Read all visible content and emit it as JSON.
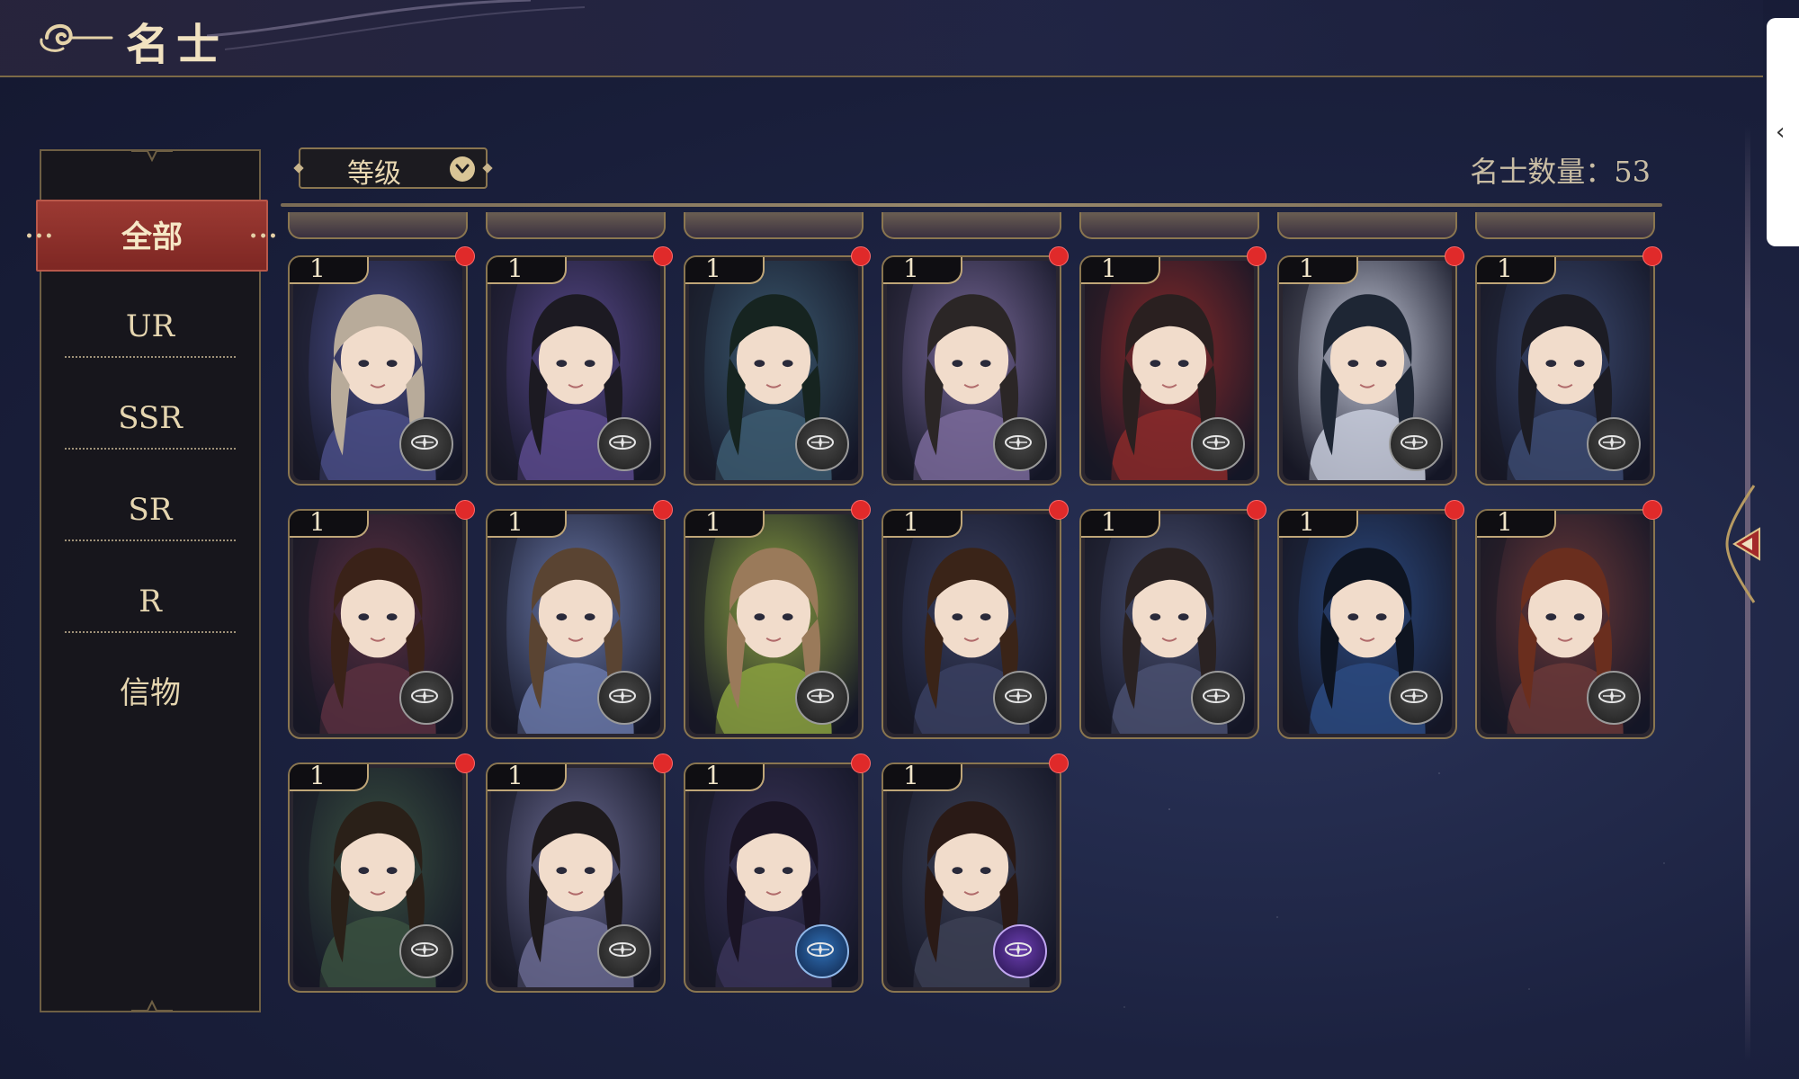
{
  "header": {
    "title": "名士",
    "back_icon": "cloud-swirl-back-icon"
  },
  "filters": [
    {
      "label": "全部",
      "active": true
    },
    {
      "label": "UR",
      "active": false
    },
    {
      "label": "SSR",
      "active": false
    },
    {
      "label": "SR",
      "active": false
    },
    {
      "label": "R",
      "active": false
    },
    {
      "label": "信物",
      "active": false
    }
  ],
  "sort": {
    "label": "等级",
    "icon": "chevron-down-icon"
  },
  "count": {
    "text": "名士数量：53"
  },
  "side_panel": {
    "collapse_icon": "chevron-left-icon"
  },
  "colors": {
    "accent_red": "#9c3a33",
    "gold": "#8a7650",
    "badge_dot": "#e02a2a"
  },
  "cards": [
    {
      "level": "1",
      "hair": "#b8ab9a",
      "tone": "#4a4d86",
      "emblem": "gray"
    },
    {
      "level": "1",
      "hair": "#1c1a22",
      "tone": "#5a4a8c",
      "emblem": "gray"
    },
    {
      "level": "1",
      "hair": "#162420",
      "tone": "#3c5a70",
      "emblem": "gray"
    },
    {
      "level": "1",
      "hair": "#2b2626",
      "tone": "#7a6a9a",
      "emblem": "gray"
    },
    {
      "level": "1",
      "hair": "#2a2020",
      "tone": "#8a2a2a",
      "emblem": "gray"
    },
    {
      "level": "1",
      "hair": "#1e2634",
      "tone": "#c8ccdc",
      "emblem": "gray"
    },
    {
      "level": "1",
      "hair": "#1c1c24",
      "tone": "#3c4a70",
      "emblem": "gray"
    },
    {
      "level": "1",
      "hair": "#3a2218",
      "tone": "#5a3040",
      "emblem": "gray"
    },
    {
      "level": "1",
      "hair": "#5a4432",
      "tone": "#6a78a8",
      "emblem": "gray"
    },
    {
      "level": "1",
      "hair": "#9a7a5a",
      "tone": "#8aa040",
      "emblem": "gray"
    },
    {
      "level": "1",
      "hair": "#3a2418",
      "tone": "#3a4060",
      "emblem": "gray"
    },
    {
      "level": "1",
      "hair": "#2a2222",
      "tone": "#4a5070",
      "emblem": "gray"
    },
    {
      "level": "1",
      "hair": "#0e1420",
      "tone": "#2c4a80",
      "emblem": "gray"
    },
    {
      "level": "1",
      "hair": "#6a2e1e",
      "tone": "#6a3838",
      "emblem": "gray"
    },
    {
      "level": "1",
      "hair": "#2a2018",
      "tone": "#3a5040",
      "emblem": "gray"
    },
    {
      "level": "1",
      "hair": "#1e1a1c",
      "tone": "#6a6a90",
      "emblem": "gray"
    },
    {
      "level": "1",
      "hair": "#1a1424",
      "tone": "#3a3458",
      "emblem": "blue"
    },
    {
      "level": "1",
      "hair": "#2a1a16",
      "tone": "#3c4054",
      "emblem": "purple"
    }
  ]
}
